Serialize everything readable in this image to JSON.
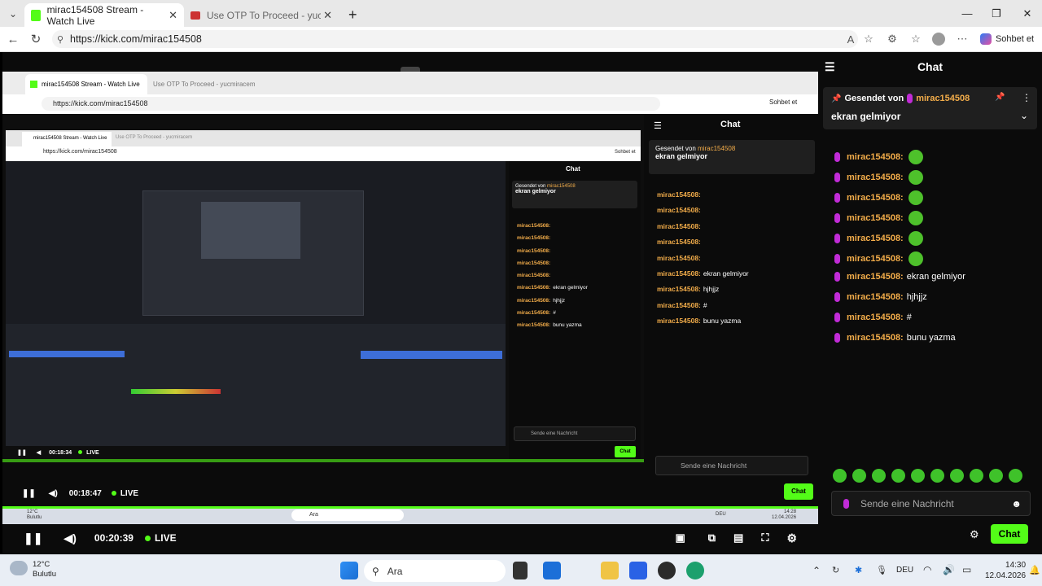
{
  "browser": {
    "tabs": [
      {
        "title": "mirac154508 Stream - Watch Live",
        "active": true
      },
      {
        "title": "Use OTP To Proceed - yucmiracem",
        "active": false
      }
    ],
    "url": "https://kick.com/mirac154508",
    "copilot_label": "Sohbet et",
    "new_tab": "+",
    "close_tab": "✕"
  },
  "nested": {
    "level1": {
      "tab1": "mirac154508 Stream - Watch Live",
      "tab2": "Use OTP To Proceed - yucmiracem",
      "url": "https://kick.com/mirac154508",
      "copilot": "Sohbet et",
      "time": "00:18:47",
      "live": "LIVE"
    },
    "level2": {
      "tab1": "mirac154508 Stream - Watch Live",
      "tab2": "Use OTP To Proceed - yucmiracem",
      "url": "https://kick.com/mirac154508",
      "copilot": "Sohbet et",
      "time": "00:18:34",
      "live": "LIVE"
    }
  },
  "player": {
    "time": "00:20:39",
    "live_label": "LIVE",
    "weather_temp": "12°C",
    "weather_desc": "Bulutlu",
    "search": "Ara",
    "lang": "DEU",
    "clock_time": "14:28",
    "clock_date": "12.04.2026"
  },
  "chat": {
    "title": "Chat",
    "pinned_prefix": "Gesendet von",
    "pinned_user": "mirac154508",
    "pinned_text": "ekran gelmiyor",
    "messages": [
      {
        "user": "mirac154508:",
        "text": "",
        "emote": true
      },
      {
        "user": "mirac154508:",
        "text": "",
        "emote": true
      },
      {
        "user": "mirac154508:",
        "text": "",
        "emote": true
      },
      {
        "user": "mirac154508:",
        "text": "",
        "emote": true
      },
      {
        "user": "mirac154508:",
        "text": "",
        "emote": true
      },
      {
        "user": "mirac154508:",
        "text": "",
        "emote": true
      },
      {
        "user": "mirac154508:",
        "text": "ekran gelmiyor",
        "emote": false
      },
      {
        "user": "mirac154508:",
        "text": "hjhjjz",
        "emote": false
      },
      {
        "user": "mirac154508:",
        "text": "#",
        "emote": false
      },
      {
        "user": "mirac154508:",
        "text": "bunu yazma",
        "emote": false
      }
    ],
    "nested_messages": [
      {
        "user": "mirac154508:",
        "text": ""
      },
      {
        "user": "mirac154508:",
        "text": ""
      },
      {
        "user": "mirac154508:",
        "text": ""
      },
      {
        "user": "mirac154508:",
        "text": ""
      },
      {
        "user": "mirac154508:",
        "text": ""
      },
      {
        "user": "mirac154508:",
        "text": "ekran gelmiyor"
      },
      {
        "user": "mirac154508:",
        "text": "hjhjjz"
      },
      {
        "user": "mirac154508:",
        "text": "#"
      },
      {
        "user": "mirac154508:",
        "text": "bunu yazma"
      }
    ],
    "input_placeholder": "Sende eine Nachricht",
    "send_label": "Chat"
  },
  "taskbar": {
    "weather_temp": "12°C",
    "weather_desc": "Bulutlu",
    "search": "Ara",
    "lang": "DEU",
    "time": "14:30",
    "date": "12.04.2026"
  },
  "colors": {
    "kick_green": "#53fc18",
    "username": "#f3ad4a",
    "mic": "#c12bd7"
  }
}
